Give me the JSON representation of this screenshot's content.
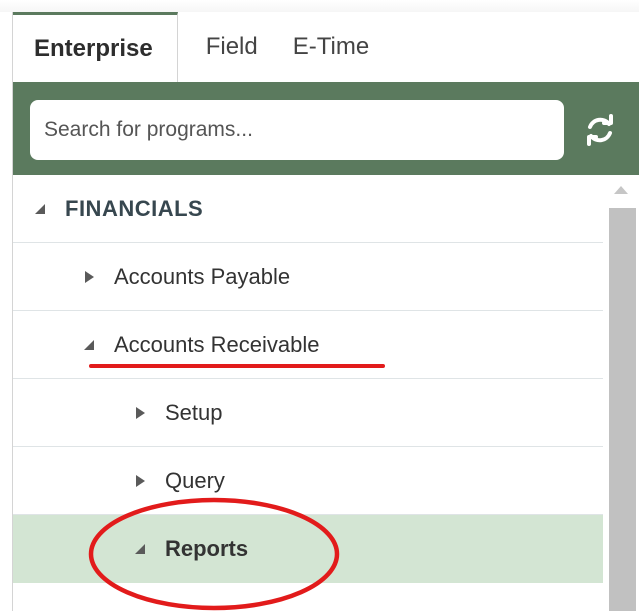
{
  "tabs": [
    {
      "label": "Enterprise",
      "active": true
    },
    {
      "label": "Field",
      "active": false
    },
    {
      "label": "E-Time",
      "active": false
    }
  ],
  "search": {
    "placeholder": "Search for programs...",
    "refresh_icon": "refresh-icon"
  },
  "tree": {
    "root": {
      "label": "FINANCIALS",
      "expanded": true
    },
    "items": [
      {
        "label": "Accounts Payable",
        "expanded": false
      },
      {
        "label": "Accounts Receivable",
        "expanded": true
      },
      {
        "label": "Setup",
        "expanded": false
      },
      {
        "label": "Query",
        "expanded": false
      },
      {
        "label": "Reports",
        "expanded": true,
        "selected": true
      }
    ]
  },
  "colors": {
    "accent": "#5b7a5e",
    "highlight": "#d3e5d3",
    "annotation": "#e21b1b"
  }
}
